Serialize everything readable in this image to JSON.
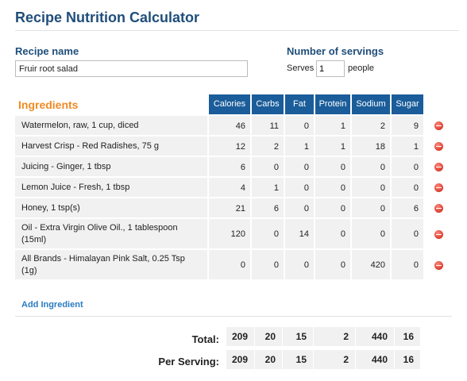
{
  "title": "Recipe Nutrition Calculator",
  "recipe": {
    "label": "Recipe name",
    "value": "Fruir root salad"
  },
  "servings": {
    "label": "Number of servings",
    "prefix": "Serves",
    "value": "1",
    "suffix": "people"
  },
  "ingredients_heading": "Ingredients",
  "columns": [
    "Calories",
    "Carbs",
    "Fat",
    "Protein",
    "Sodium",
    "Sugar"
  ],
  "ingredients": [
    {
      "name": "Watermelon, raw, 1 cup, diced",
      "values": [
        "46",
        "11",
        "0",
        "1",
        "2",
        "9"
      ]
    },
    {
      "name": "Harvest Crisp - Red Radishes, 75 g",
      "values": [
        "12",
        "2",
        "1",
        "1",
        "18",
        "1"
      ]
    },
    {
      "name": "Juicing - Ginger, 1 tbsp",
      "values": [
        "6",
        "0",
        "0",
        "0",
        "0",
        "0"
      ]
    },
    {
      "name": "Lemon Juice - Fresh, 1 tbsp",
      "values": [
        "4",
        "1",
        "0",
        "0",
        "0",
        "0"
      ]
    },
    {
      "name": "Honey, 1 tsp(s)",
      "values": [
        "21",
        "6",
        "0",
        "0",
        "0",
        "6"
      ]
    },
    {
      "name": "Oil - Extra Virgin Olive Oil., 1 tablespoon (15ml)",
      "values": [
        "120",
        "0",
        "14",
        "0",
        "0",
        "0"
      ]
    },
    {
      "name": "All Brands - Himalayan Pink Salt, 0.25 Tsp (1g)",
      "values": [
        "0",
        "0",
        "0",
        "0",
        "420",
        "0"
      ]
    }
  ],
  "add_ingredient": "Add Ingredient",
  "totals": {
    "total_label": "Total:",
    "total": [
      "209",
      "20",
      "15",
      "2",
      "440",
      "16"
    ],
    "per_serving_label": "Per Serving:",
    "per_serving": [
      "209",
      "20",
      "15",
      "2",
      "440",
      "16"
    ]
  },
  "colors": {
    "heading_blue": "#1f4e7a",
    "header_bg": "#1a5d9a",
    "accent_orange": "#f08a24",
    "link_blue": "#2a7bc0",
    "remove_red": "#d83a2a"
  }
}
